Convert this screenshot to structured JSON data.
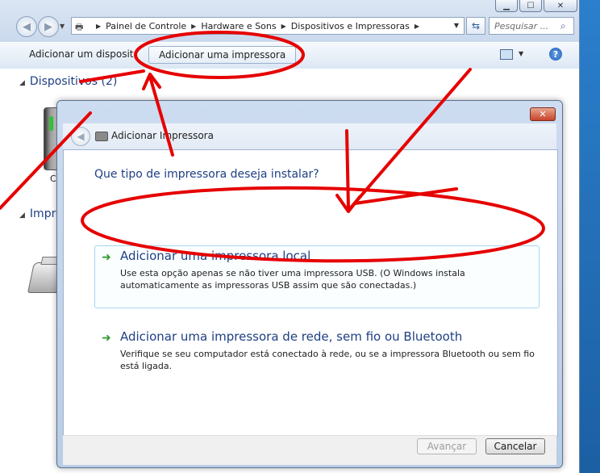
{
  "explorer": {
    "caption_buttons": [
      "▁",
      "☐",
      "✕"
    ],
    "breadcrumbs": [
      "Painel de Controle",
      "Hardware e Sons",
      "Dispositivos e Impressoras"
    ],
    "search_placeholder": "Pesquisar ...",
    "commands": {
      "add_device": "Adicionar um dispositivo",
      "add_printer": "Adicionar uma impressora"
    },
    "groups": {
      "devices": "Dispositivos (2)",
      "printers_truncated": "Impre"
    },
    "device_label_truncated": "C"
  },
  "dialog": {
    "title": "Adicionar Impressora",
    "close_glyph": "✕",
    "question": "Que tipo de impressora deseja instalar?",
    "options": [
      {
        "title": "Adicionar uma impressora local",
        "description": "Use esta opção apenas se não tiver uma impressora USB. (O Windows instala automaticamente as impressoras USB assim que são conectadas.)"
      },
      {
        "title": "Adicionar uma impressora de rede, sem fio ou Bluetooth",
        "description": "Verifique se seu computador está conectado à rede, ou se a impressora Bluetooth ou sem fio está ligada."
      }
    ],
    "buttons": {
      "next": "Avançar",
      "cancel": "Cancelar"
    }
  },
  "annotation_color": "#e60000"
}
